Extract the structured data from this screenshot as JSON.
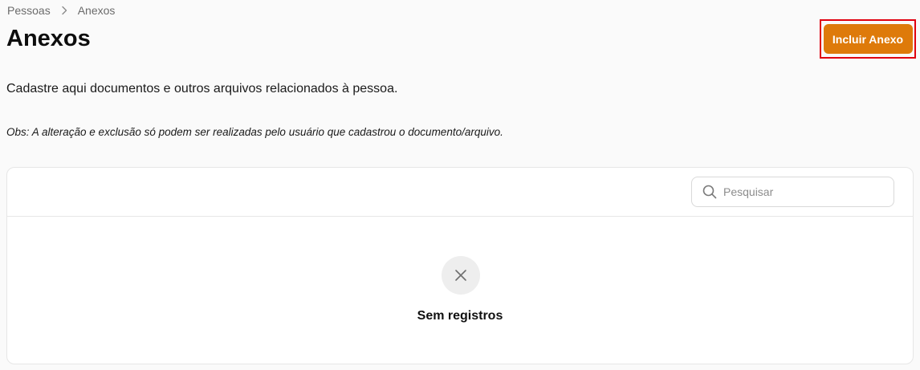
{
  "breadcrumb": {
    "items": [
      "Pessoas",
      "Anexos"
    ],
    "separator_icon": "chevron-right-icon"
  },
  "header": {
    "title": "Anexos",
    "primary_action_label": "Incluir Anexo"
  },
  "content": {
    "description": "Cadastre aqui documentos e outros arquivos relacionados à pessoa.",
    "note": "Obs: A alteração e exclusão só podem ser realizadas pelo usuário que cadastrou o documento/arquivo."
  },
  "table": {
    "search": {
      "placeholder": "Pesquisar",
      "value": "",
      "icon": "search-icon"
    },
    "empty_state": {
      "icon": "close-icon",
      "text": "Sem registros"
    }
  },
  "colors": {
    "primary": "#de7a0a",
    "highlight_border": "#e0000f",
    "background": "#fafafa"
  }
}
